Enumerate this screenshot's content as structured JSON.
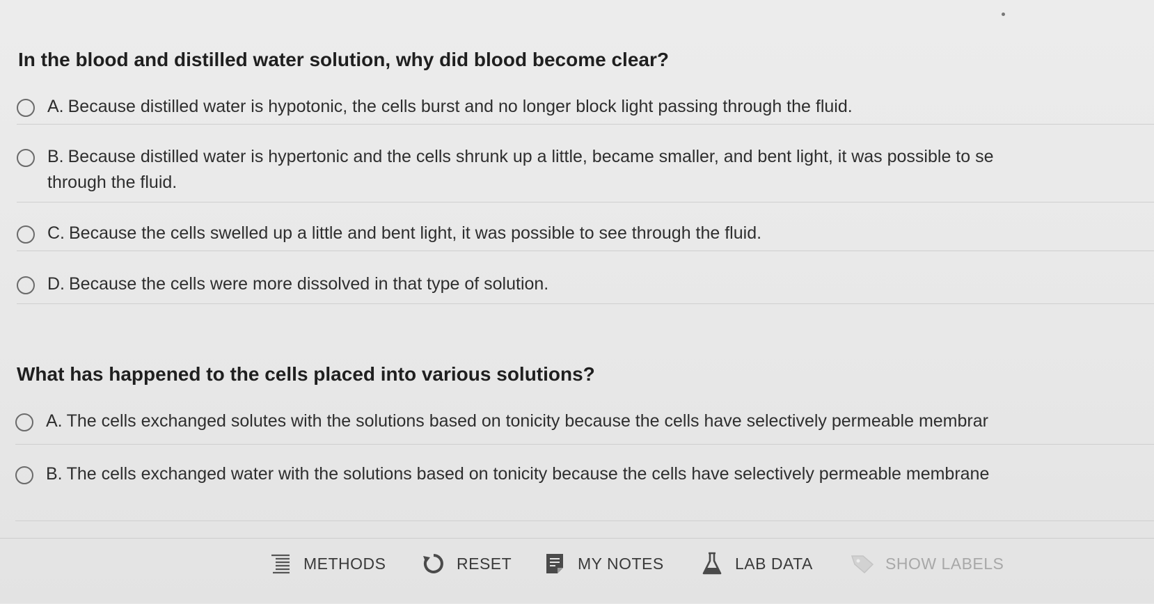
{
  "questions": [
    {
      "title": "In the blood and distilled water solution, why did blood become clear?",
      "options": [
        {
          "letter": "A.",
          "text": "Because distilled water is hypotonic, the cells burst and no longer block light passing through the fluid."
        },
        {
          "letter": "B.",
          "text": "Because distilled water is hypertonic and the cells shrunk up a little, became smaller, and bent light, it was possible to se",
          "text2": "through the fluid."
        },
        {
          "letter": "C.",
          "text": "Because the cells swelled up a little and bent light, it was possible to see through the fluid."
        },
        {
          "letter": "D.",
          "text": "Because the cells were more dissolved in that type of solution."
        }
      ]
    },
    {
      "title": "What has happened to the cells placed into various solutions?",
      "options": [
        {
          "letter": "A.",
          "text": "The cells exchanged solutes with the solutions based on tonicity because the cells have selectively permeable membrar"
        },
        {
          "letter": "B.",
          "text": "The cells exchanged water with the solutions based on tonicity because the cells have selectively permeable membrane"
        }
      ]
    }
  ],
  "toolbar": {
    "methods": {
      "label": "METHODS",
      "icon": "list-icon"
    },
    "reset": {
      "label": "RESET",
      "icon": "reset-icon"
    },
    "my_notes": {
      "label": "MY NOTES",
      "icon": "notes-icon"
    },
    "lab_data": {
      "label": "LAB DATA",
      "icon": "flask-icon"
    },
    "show_labels": {
      "label": "SHOW LABELS",
      "icon": "tag-icon",
      "state": "disabled"
    }
  },
  "colors": {
    "background": "#e9e9e9",
    "text": "#2b2b2b",
    "radio_border": "#6a6a6a",
    "disabled": "#a8a8a8"
  }
}
